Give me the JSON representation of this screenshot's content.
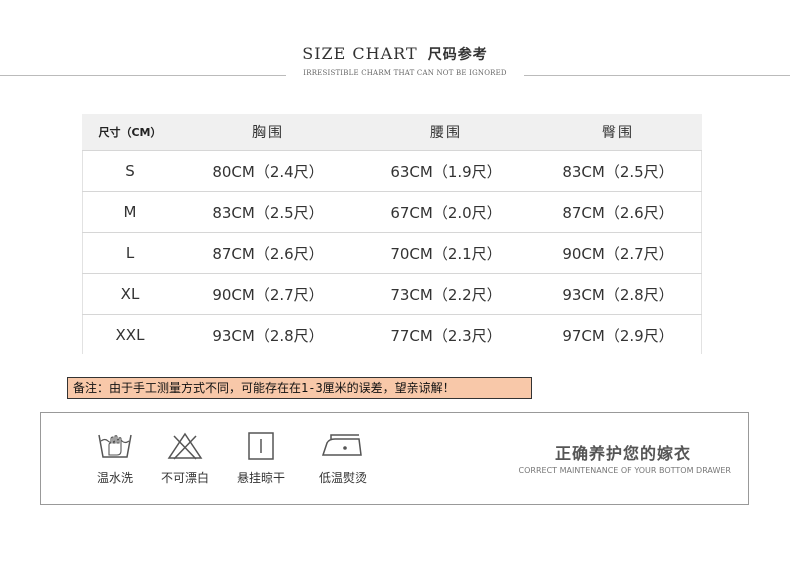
{
  "header": {
    "title_en": "SIZE CHART",
    "title_cn": "尺码参考",
    "subtitle": "IRRESISTIBLE CHARM THAT CAN NOT BE IGNORED"
  },
  "table": {
    "headers": [
      "尺寸（CM）",
      "胸围",
      "腰围",
      "臀围"
    ],
    "rows": [
      [
        "S",
        "80CM（2.4尺）",
        "63CM（1.9尺）",
        "83CM（2.5尺）"
      ],
      [
        "M",
        "83CM（2.5尺）",
        "67CM（2.0尺）",
        "87CM（2.6尺）"
      ],
      [
        "L",
        "87CM（2.6尺）",
        "70CM（2.1尺）",
        "90CM（2.7尺）"
      ],
      [
        "XL",
        "90CM（2.7尺）",
        "73CM（2.2尺）",
        "93CM（2.8尺）"
      ],
      [
        "XXL",
        "93CM（2.8尺）",
        "77CM（2.3尺）",
        "97CM（2.9尺）"
      ]
    ]
  },
  "note": "备注：由于手工测量方式不同，可能存在在1-3厘米的误差，望亲谅解！",
  "care": {
    "items": [
      {
        "icon": "hand-wash-icon",
        "label": "温水洗"
      },
      {
        "icon": "no-bleach-icon",
        "label": "不可漂白"
      },
      {
        "icon": "hang-dry-icon",
        "label": "悬挂晾干"
      },
      {
        "icon": "low-iron-icon",
        "label": "低温熨烫"
      }
    ],
    "title": "正确养护您的嫁衣",
    "subtitle": "CORRECT MAINTENANCE OF YOUR BOTTOM DRAWER"
  },
  "colors": {
    "note_bg": "#f8c8a9",
    "header_bg": "#f0f0f0"
  }
}
